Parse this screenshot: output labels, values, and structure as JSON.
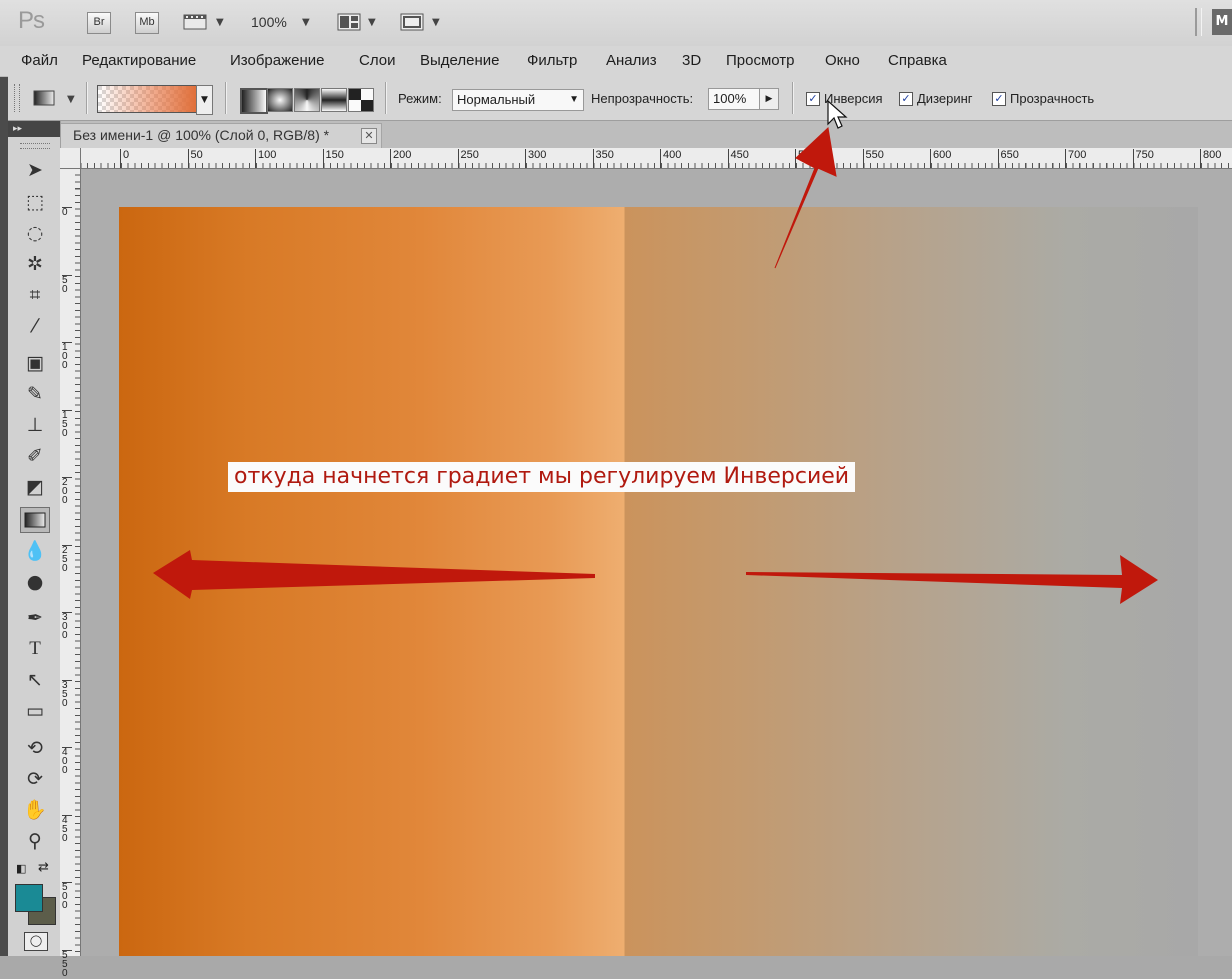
{
  "appbar": {
    "logo": "Ps",
    "bridge_label": "Br",
    "minibridge_label": "Mb",
    "zoom_value": "100%",
    "workspace_label": "M"
  },
  "menu": [
    "Файл",
    "Редактирование",
    "Изображение",
    "Слои",
    "Выделение",
    "Фильтр",
    "Анализ",
    "3D",
    "Просмотр",
    "Окно",
    "Справка"
  ],
  "options": {
    "mode_label": "Режим:",
    "mode_value": "Нормальный",
    "opacity_label": "Непрозрачность:",
    "opacity_value": "100%",
    "reverse_label": "Инверсия",
    "reverse_checked": true,
    "dither_label": "Дизеринг",
    "dither_checked": true,
    "transparency_label": "Прозрачность",
    "transparency_checked": true
  },
  "document": {
    "tab_title": "Без имени-1 @ 100% (Слой 0, RGB/8) *",
    "gradient_colors": [
      "#cb6710",
      "#eeae70",
      "#cb935c",
      "#a8a8a8"
    ]
  },
  "ruler_h": [
    "0",
    "50",
    "100",
    "150",
    "200",
    "250",
    "300",
    "350",
    "400",
    "450",
    "500",
    "550",
    "600",
    "650",
    "700",
    "750",
    "800"
  ],
  "ruler_v": [
    "0",
    "50",
    "100",
    "150",
    "200",
    "250",
    "300",
    "350",
    "400",
    "450",
    "500",
    "550"
  ],
  "tools": {
    "foreground_color": "#1a8a95",
    "background_color": "#5c5d4a"
  },
  "annotation": {
    "caption": "откуда начнется градиет мы регулируем Инверсией",
    "arrow_color": "#c0180c"
  }
}
